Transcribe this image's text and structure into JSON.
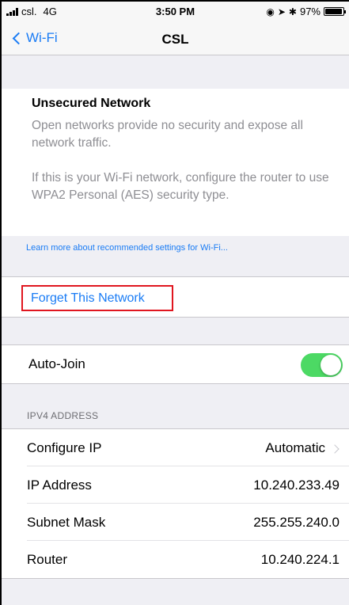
{
  "status_bar": {
    "carrier": "csl.",
    "network": "4G",
    "time": "3:50 PM",
    "battery": "97%",
    "battery_level": 0.97,
    "icons": [
      "signal-icon",
      "location-icon",
      "bluetooth-icon",
      "orientation-lock-icon",
      "battery-icon"
    ]
  },
  "nav": {
    "back_label": "Wi-Fi",
    "title": "CSL"
  },
  "info": {
    "title": "Unsecured Network",
    "paragraph1": "Open networks provide no security and expose all network traffic.",
    "paragraph2": "If this is your Wi-Fi network, configure the router to use WPA2 Personal (AES) security type.",
    "learn_more": "Learn more about recommended settings for Wi-Fi..."
  },
  "forget": {
    "label": "Forget This Network",
    "highlight_color": "#e0161f"
  },
  "auto_join": {
    "label": "Auto-Join",
    "enabled": true,
    "toggle_color": "#4cd964"
  },
  "ipv4": {
    "header": "IPV4 ADDRESS",
    "configure_label": "Configure IP",
    "configure_value": "Automatic",
    "ip_label": "IP Address",
    "ip_value": "10.240.233.49",
    "subnet_label": "Subnet Mask",
    "subnet_value": "255.255.240.0",
    "router_label": "Router",
    "router_value": "10.240.224.1"
  },
  "colors": {
    "accent": "#1a7cf5",
    "background": "#efeff4"
  }
}
